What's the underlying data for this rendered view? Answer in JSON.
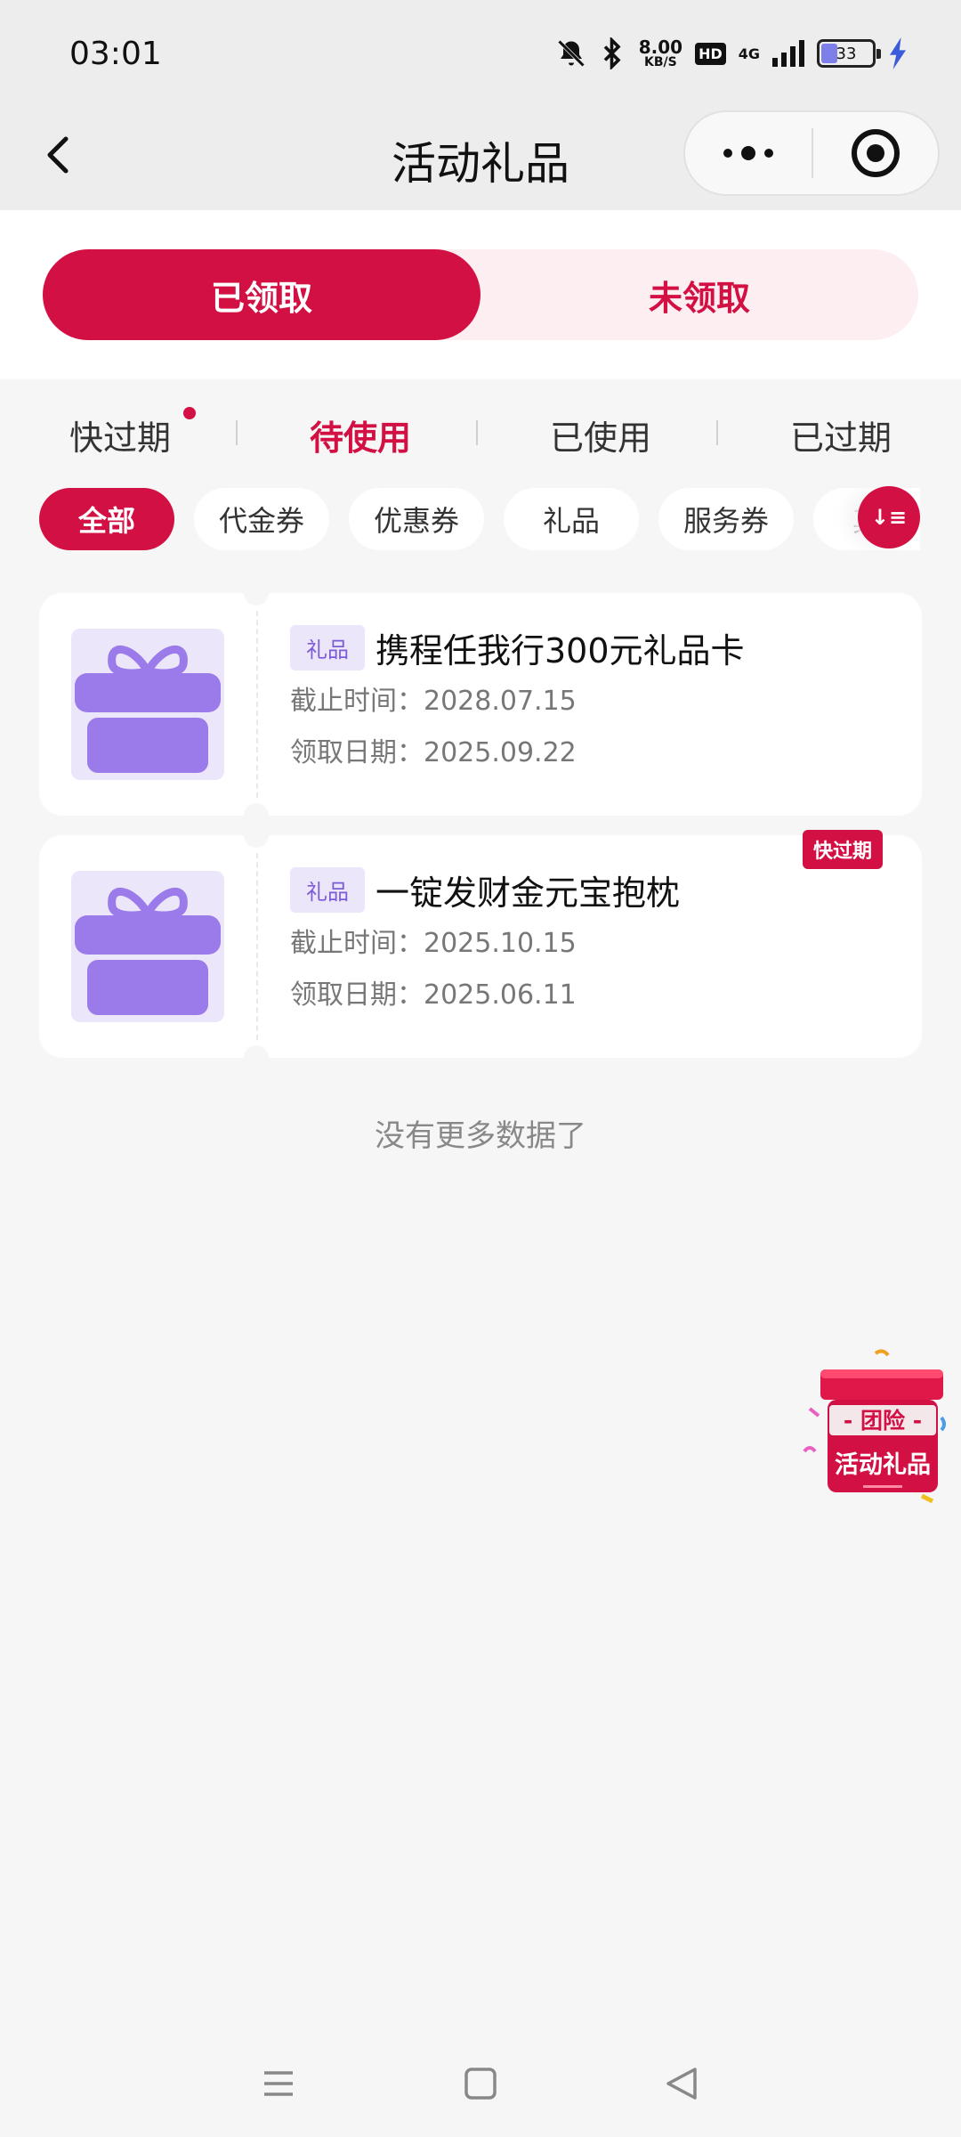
{
  "status_bar": {
    "time": "03:01",
    "speed_value": "8.00",
    "speed_unit": "KB/S",
    "hd": "HD",
    "network": "4G",
    "battery": "33",
    "icons": [
      "mute-bell-icon",
      "bluetooth-icon",
      "signal-icon",
      "battery-icon",
      "charging-icon"
    ]
  },
  "nav": {
    "title": "活动礼品",
    "back_icon": "chevron-left-icon",
    "more_icon": "more-dots-icon",
    "close_icon": "target-icon"
  },
  "segment": {
    "options": [
      {
        "label": "已领取",
        "active": true
      },
      {
        "label": "未领取",
        "active": false
      }
    ]
  },
  "status_tabs": [
    {
      "label": "快过期",
      "active": false,
      "dot": true
    },
    {
      "label": "待使用",
      "active": true,
      "dot": false
    },
    {
      "label": "已使用",
      "active": false,
      "dot": false
    },
    {
      "label": "已过期",
      "active": false,
      "dot": false
    }
  ],
  "filters": {
    "chips": [
      {
        "label": "全部",
        "active": true
      },
      {
        "label": "代金券",
        "active": false
      },
      {
        "label": "优惠券",
        "active": false
      },
      {
        "label": "礼品",
        "active": false
      },
      {
        "label": "服务券",
        "active": false
      },
      {
        "label": "其他",
        "active": false
      }
    ],
    "sort_icon": "sort-icon",
    "sort_label": "↓≡"
  },
  "cards": [
    {
      "tag": "礼品",
      "title": "携程任我行300元礼品卡",
      "deadline_label": "截止时间：",
      "deadline": "2028.07.15",
      "received_label": "领取日期：",
      "received": "2025.09.22",
      "badge": ""
    },
    {
      "tag": "礼品",
      "title": "一锭发财金元宝抱枕",
      "deadline_label": "截止时间：",
      "deadline": "2025.10.15",
      "received_label": "领取日期：",
      "received": "2025.06.11",
      "badge": "快过期"
    }
  ],
  "footer_note": "没有更多数据了",
  "floating_entry": {
    "line1": "- 团险 -",
    "line2": "活动礼品"
  },
  "colors": {
    "accent": "#d21043",
    "accent_light": "#fdeef1",
    "gift_purple": "#9b7bea",
    "tag_bg": "#ece6fb"
  }
}
